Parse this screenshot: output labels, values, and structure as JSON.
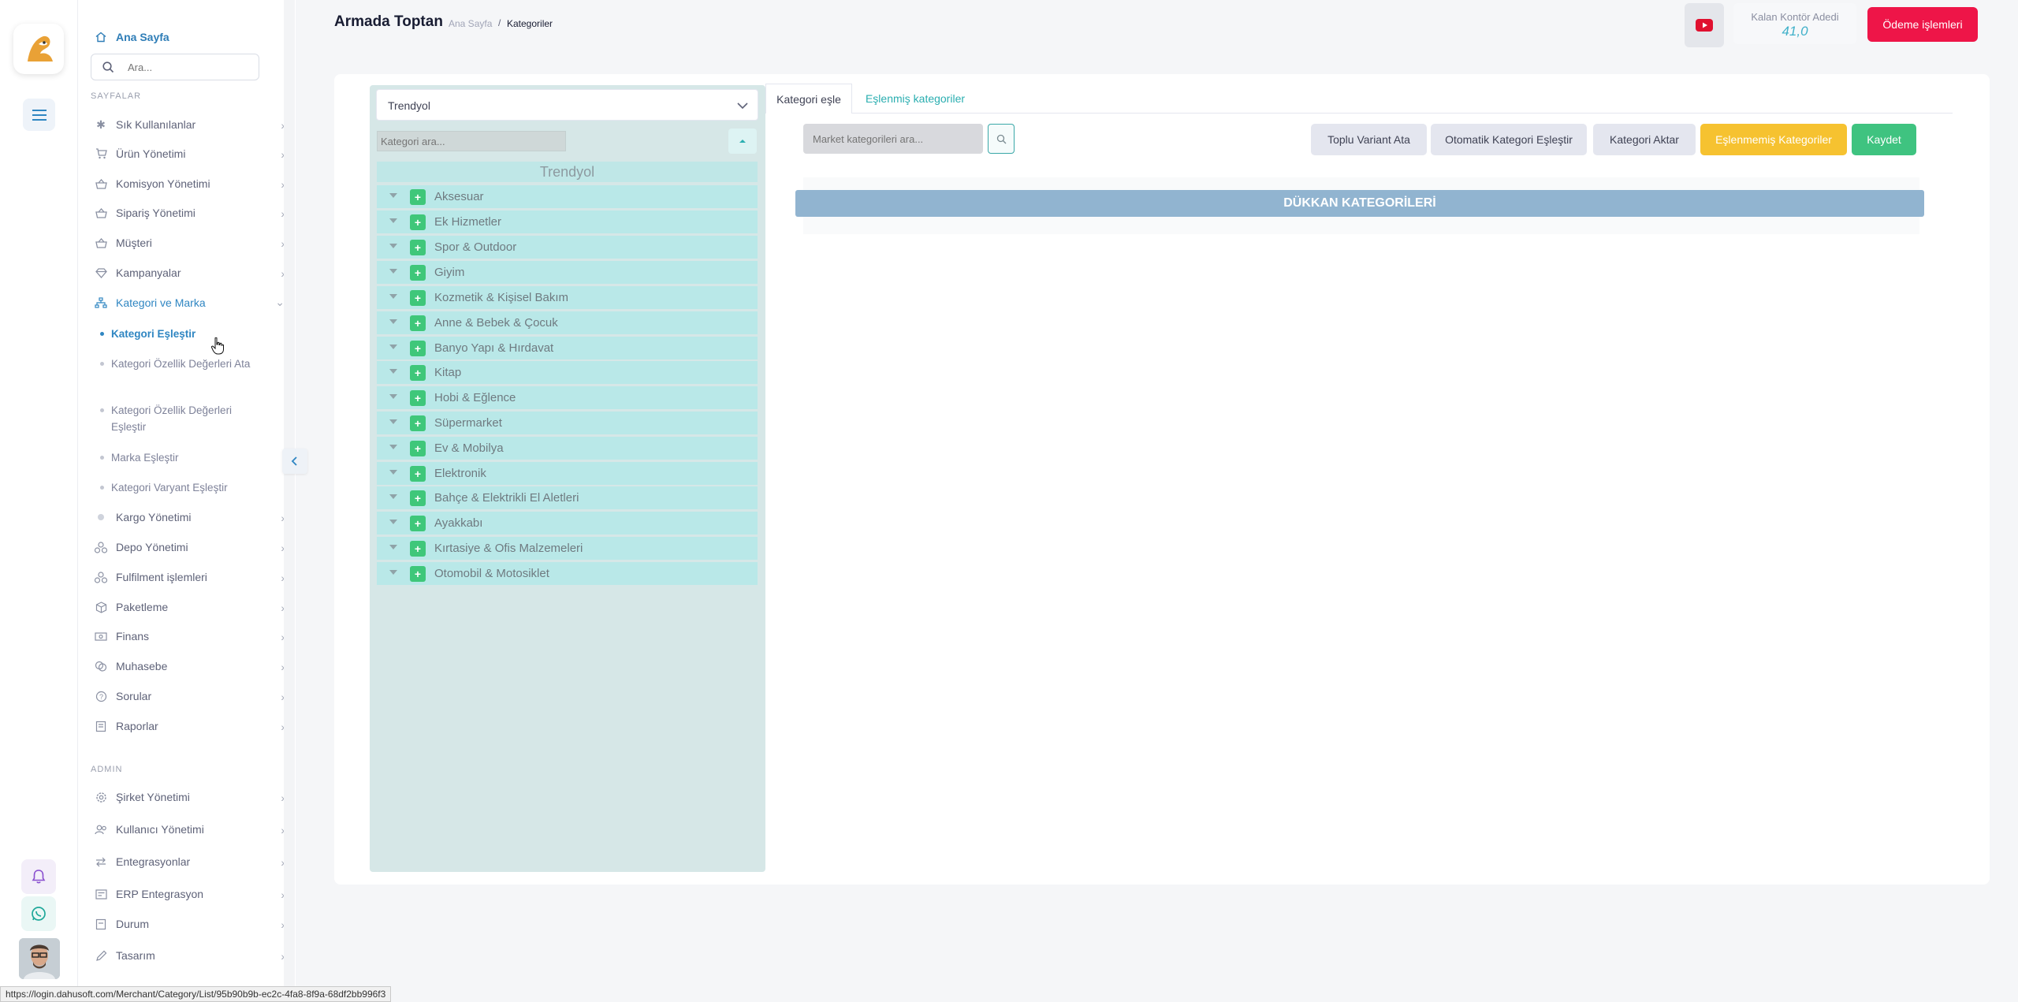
{
  "sidebar": {
    "home": "Ana Sayfa",
    "search_placeholder": "Ara...",
    "section_pages": "SAYFALAR",
    "section_admin": "ADMIN",
    "items": [
      {
        "label": "Sık Kullanılanlar",
        "icon": "asterisk-icon"
      },
      {
        "label": "Ürün Yönetimi",
        "icon": "cart-icon"
      },
      {
        "label": "Komisyon Yönetimi",
        "icon": "basket-icon"
      },
      {
        "label": "Sipariş Yönetimi",
        "icon": "basket-icon"
      },
      {
        "label": "Müşteri",
        "icon": "basket-icon"
      },
      {
        "label": "Kampanyalar",
        "icon": "gem-icon"
      },
      {
        "label": "Kategori ve Marka",
        "icon": "sitemap-icon"
      }
    ],
    "sub_items": [
      {
        "label": "Kategori Eşleştir"
      },
      {
        "label": "Kategori Özellik Değerleri Ata"
      },
      {
        "label": "Kategori Özellik Değerleri Eşleştir"
      },
      {
        "label": "Marka Eşleştir"
      },
      {
        "label": "Kategori Varyant Eşleştir"
      }
    ],
    "items_after": [
      {
        "label": "Kargo Yönetimi",
        "icon": "truck-icon"
      },
      {
        "label": "Depo Yönetimi",
        "icon": "boxes-icon"
      },
      {
        "label": "Fulfilment işlemleri",
        "icon": "boxes-icon"
      },
      {
        "label": "Paketleme",
        "icon": "package-icon"
      },
      {
        "label": "Finans",
        "icon": "money-icon"
      },
      {
        "label": "Muhasebe",
        "icon": "coins-icon"
      },
      {
        "label": "Sorular",
        "icon": "question-icon"
      },
      {
        "label": "Raporlar",
        "icon": "report-icon"
      }
    ],
    "admin_items": [
      {
        "label": "Şirket Yönetimi",
        "icon": "gear-icon"
      },
      {
        "label": "Kullanıcı Yönetimi",
        "icon": "users-icon"
      },
      {
        "label": "Entegrasyonlar",
        "icon": "exchange-icon"
      },
      {
        "label": "ERP Entegrasyon",
        "icon": "erp-icon"
      },
      {
        "label": "Durum",
        "icon": "status-icon"
      },
      {
        "label": "Tasarım",
        "icon": "pen-icon"
      }
    ]
  },
  "header": {
    "title": "Armada Toptan",
    "breadcrumb_home": "Ana Sayfa",
    "breadcrumb_sep": "/",
    "breadcrumb_current": "Kategoriler",
    "credit_label": "Kalan Kontör Adedi",
    "credit_value": "41,0",
    "pay_button": "Ödeme işlemleri"
  },
  "category_panel": {
    "market_selected": "Trendyol",
    "search_placeholder": "Kategori ara...",
    "root_label": "Trendyol",
    "categories": [
      "Aksesuar",
      "Ek Hizmetler",
      "Spor & Outdoor",
      "Giyim",
      "Kozmetik & Kişisel Bakım",
      "Anne & Bebek & Çocuk",
      "Banyo Yapı & Hırdavat",
      "Kitap",
      "Hobi & Eğlence",
      "Süpermarket",
      "Ev & Mobilya",
      "Elektronik",
      "Bahçe & Elektrikli El Aletleri",
      "Ayakkabı",
      "Kırtasiye & Ofis Malzemeleri",
      "Otomobil & Motosiklet"
    ]
  },
  "tabs": {
    "match": "Kategori eşle",
    "matched": "Eşlenmiş kategoriler"
  },
  "toolbar": {
    "market_search_placeholder": "Market kategorileri ara...",
    "bulk_variant": "Toplu Variant Ata",
    "auto_match": "Otomatik Kategori Eşleştir",
    "transfer": "Kategori Aktar",
    "unmatched": "Eşlenmemiş Kategoriler",
    "save": "Kaydet"
  },
  "shop": {
    "header": "DÜKKAN KATEGORİLERİ"
  },
  "status_bar": "https://login.dahusoft.com/Merchant/Category/List/95b90b9b-ec2c-4fa8-8f9a-68df2bb996f3",
  "colors": {
    "accent_blue": "#2f86c2",
    "pay_red": "#ee1548",
    "warning_yellow": "#f6c230",
    "success_green": "#3fc380",
    "tree_row": "#b9e8e8",
    "shop_header": "#91b4d0"
  }
}
